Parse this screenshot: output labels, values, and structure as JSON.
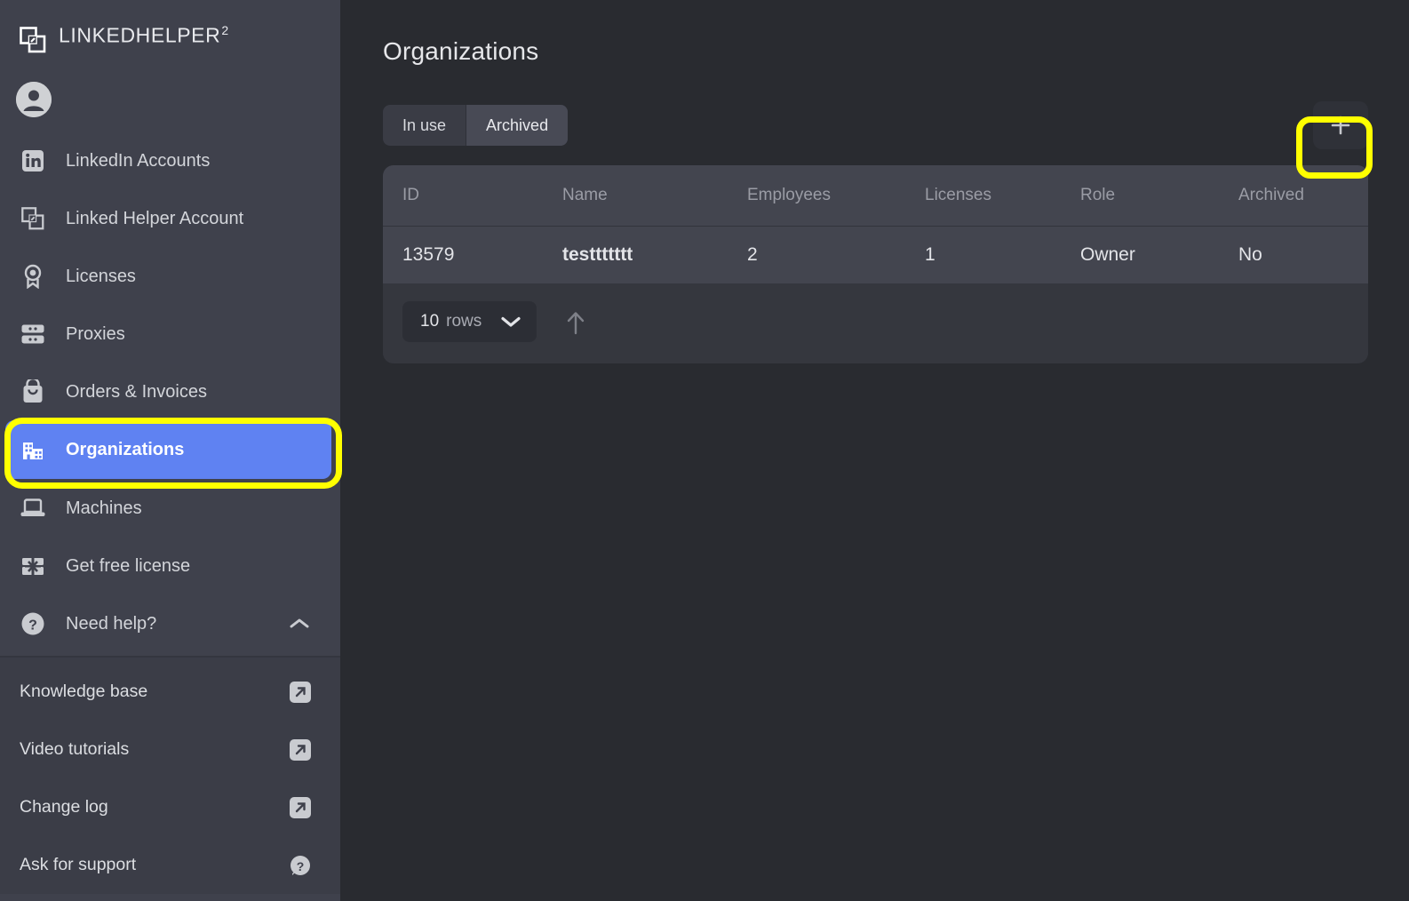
{
  "brand": {
    "name": "LINKEDHELPER",
    "superscript": "2",
    "logo_icon": "overlapping-squares-icon"
  },
  "sidebar": {
    "avatar_icon": "user-avatar-icon",
    "items": [
      {
        "label": "LinkedIn Accounts",
        "icon": "linkedin-icon",
        "active": false
      },
      {
        "label": "Linked Helper Account",
        "icon": "overlapping-squares-icon",
        "active": false
      },
      {
        "label": "Licenses",
        "icon": "award-medal-icon",
        "active": false
      },
      {
        "label": "Proxies",
        "icon": "server-icon",
        "active": false
      },
      {
        "label": "Orders & Invoices",
        "icon": "shopping-bag-icon",
        "active": false
      },
      {
        "label": "Organizations",
        "icon": "organization-building-icon",
        "active": true
      },
      {
        "label": "Machines",
        "icon": "laptop-icon",
        "active": false
      },
      {
        "label": "Get free license",
        "icon": "gift-box-icon",
        "active": false
      },
      {
        "label": "Need help?",
        "icon": "question-circle-icon",
        "active": false,
        "chevron": "chevron-up-icon"
      }
    ],
    "links": [
      {
        "label": "Knowledge base",
        "icon": "external-link-icon"
      },
      {
        "label": "Video tutorials",
        "icon": "external-link-icon"
      },
      {
        "label": "Change log",
        "icon": "external-link-icon"
      },
      {
        "label": "Ask for support",
        "icon": "support-question-bubble-icon"
      }
    ]
  },
  "main": {
    "title": "Organizations",
    "tabs": [
      {
        "label": "In use",
        "selected": false
      },
      {
        "label": "Archived",
        "selected": true
      }
    ],
    "add_button": {
      "label": "+",
      "icon": "plus-icon"
    },
    "table": {
      "columns": [
        "ID",
        "Name",
        "Employees",
        "Licenses",
        "Role",
        "Archived"
      ],
      "rows": [
        {
          "id": "13579",
          "name": "testtttttt",
          "employees": "2",
          "licenses": "1",
          "role": "Owner",
          "archived": "No"
        }
      ]
    },
    "footer": {
      "rows_count": "10",
      "rows_unit": "rows",
      "chevron_icon": "chevron-down-icon",
      "scroll_top_icon": "arrow-up-icon"
    }
  },
  "colors": {
    "sidebar_bg": "#3f414c",
    "sidebar_links_bg": "#3b3d47",
    "main_bg": "#292b30",
    "card_bg": "#35373e",
    "table_row_bg": "#43454f",
    "active_item": "#5f82f2",
    "highlight": "#ffff00",
    "text_primary": "#e6e7ea",
    "text_muted": "#9a9ca5"
  }
}
